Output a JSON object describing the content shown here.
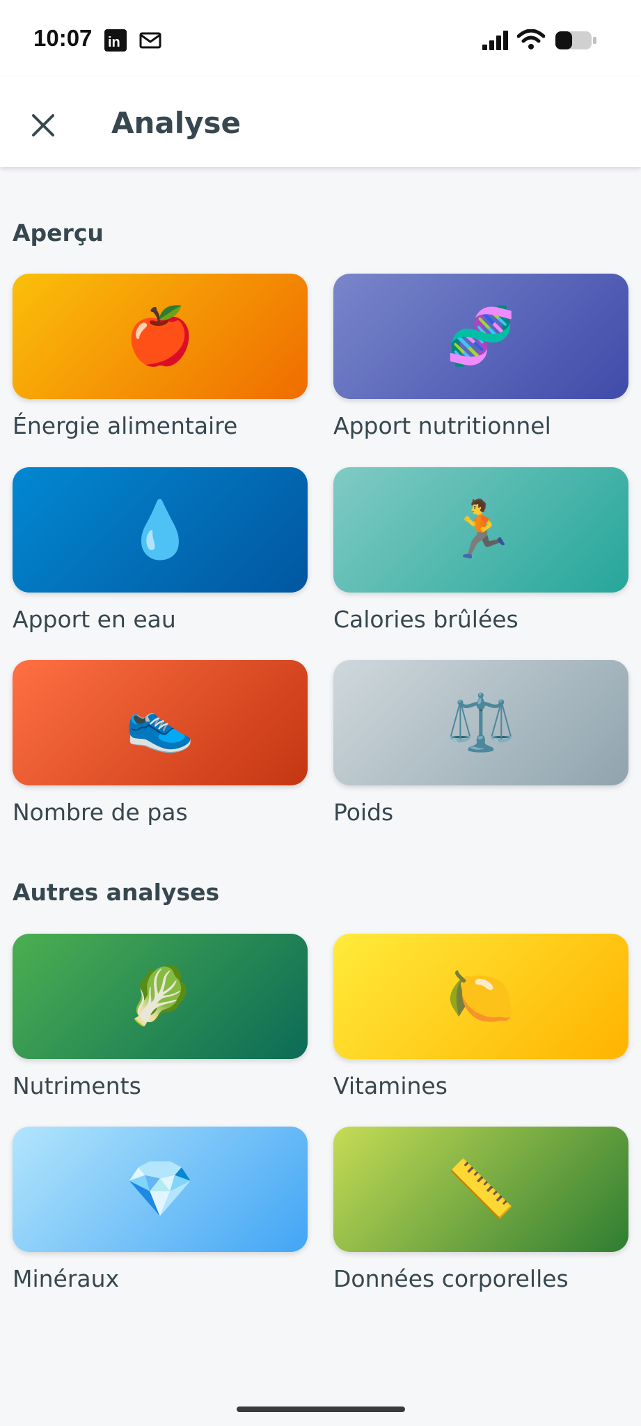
{
  "status": {
    "time": "10:07",
    "icons": [
      "linkedin-icon",
      "mail-icon",
      "signal-icon",
      "wifi-icon",
      "battery-icon"
    ]
  },
  "header": {
    "title": "Analyse",
    "close_icon": "close-icon"
  },
  "sections": [
    {
      "title": "Aperçu",
      "items": [
        {
          "label": "Énergie alimentaire",
          "emoji": "🍎",
          "icon": "apple-icon",
          "colors": [
            "#fbbf0a",
            "#ef6c00"
          ]
        },
        {
          "label": "Apport nutritionnel",
          "emoji": "🧬",
          "icon": "dna-icon",
          "colors": [
            "#7986cb",
            "#3f4ba9"
          ]
        },
        {
          "label": "Apport en eau",
          "emoji": "💧",
          "icon": "droplet-icon",
          "colors": [
            "#0288d1",
            "#0256a0"
          ]
        },
        {
          "label": "Calories brûlées",
          "emoji": "🏃",
          "icon": "runner-icon",
          "colors": [
            "#80cbc4",
            "#26a69a"
          ]
        },
        {
          "label": "Nombre de pas",
          "emoji": "👟",
          "icon": "sneaker-icon",
          "colors": [
            "#ff7043",
            "#c43512"
          ]
        },
        {
          "label": "Poids",
          "emoji": "⚖️",
          "icon": "scale-icon",
          "colors": [
            "#cfd8dc",
            "#90a4ae"
          ]
        }
      ]
    },
    {
      "title": "Autres analyses",
      "items": [
        {
          "label": "Nutriments",
          "emoji": "🥬",
          "icon": "leafy-greens-icon",
          "colors": [
            "#4caf50",
            "#0b6b57"
          ]
        },
        {
          "label": "Vitamines",
          "emoji": "🍋",
          "icon": "lemon-icon",
          "colors": [
            "#ffeb3b",
            "#ffb300"
          ]
        },
        {
          "label": "Minéraux",
          "emoji": "💎",
          "icon": "gem-icon",
          "colors": [
            "#b3e5fc",
            "#42a5f5"
          ]
        },
        {
          "label": "Données corporelles",
          "emoji": "📏",
          "icon": "ruler-icon",
          "colors": [
            "#c6dc55",
            "#2e7d32"
          ]
        }
      ]
    }
  ]
}
